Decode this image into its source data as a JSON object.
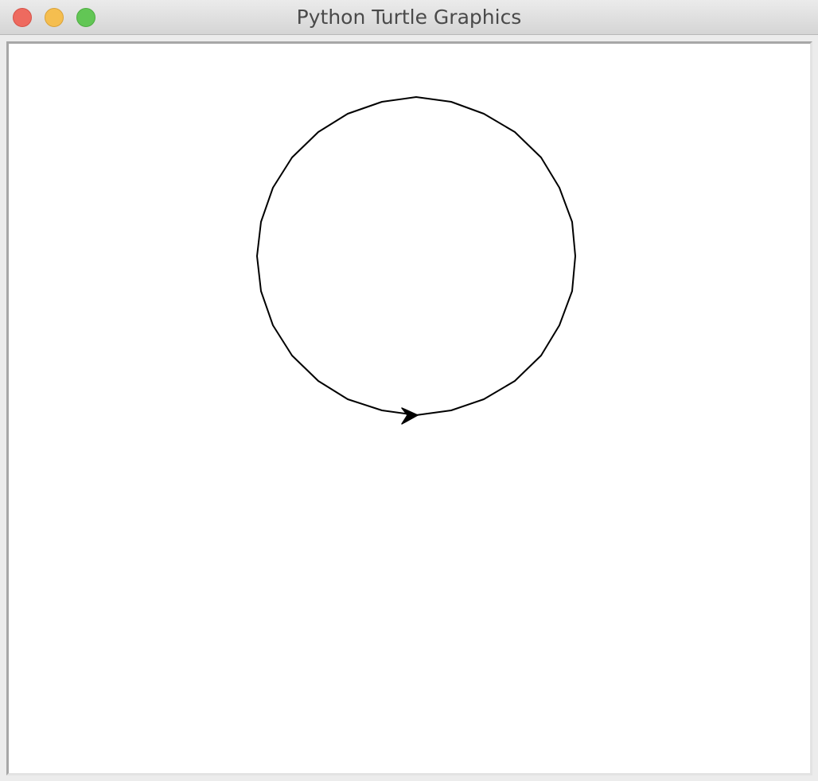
{
  "window": {
    "title": "Python Turtle Graphics"
  },
  "traffic_lights": {
    "close": "close-button",
    "minimize": "minimize-button",
    "zoom": "zoom-button"
  },
  "canvas": {
    "background": "#ffffff",
    "stroke_color": "#000000",
    "turtle_color": "#000000",
    "drawing": "circle polygon with turtle arrow at bottom pointing right"
  }
}
